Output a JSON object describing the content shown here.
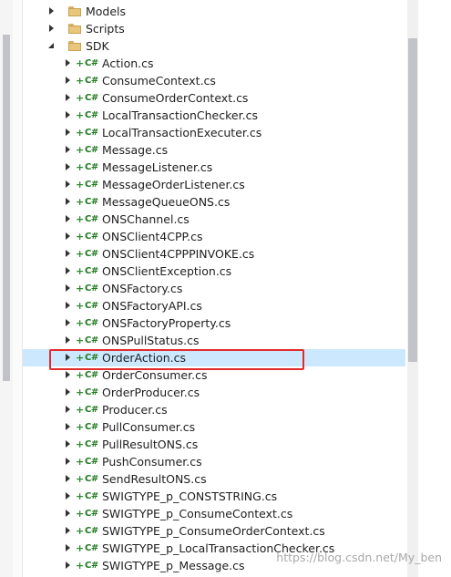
{
  "tree": {
    "folders": [
      {
        "label": "Models",
        "state": "collapsed"
      },
      {
        "label": "Scripts",
        "state": "collapsed"
      },
      {
        "label": "SDK",
        "state": "expanded"
      }
    ],
    "file_icon": "C#",
    "file_status_icon": "+",
    "files": [
      "Action.cs",
      "ConsumeContext.cs",
      "ConsumeOrderContext.cs",
      "LocalTransactionChecker.cs",
      "LocalTransactionExecuter.cs",
      "Message.cs",
      "MessageListener.cs",
      "MessageOrderListener.cs",
      "MessageQueueONS.cs",
      "ONSChannel.cs",
      "ONSClient4CPP.cs",
      "ONSClient4CPPPINVOKE.cs",
      "ONSClientException.cs",
      "ONSFactory.cs",
      "ONSFactoryAPI.cs",
      "ONSFactoryProperty.cs",
      "ONSPullStatus.cs",
      "OrderAction.cs",
      "OrderConsumer.cs",
      "OrderProducer.cs",
      "Producer.cs",
      "PullConsumer.cs",
      "PullResultONS.cs",
      "PushConsumer.cs",
      "SendResultONS.cs",
      "SWIGTYPE_p_CONSTSTRING.cs",
      "SWIGTYPE_p_ConsumeContext.cs",
      "SWIGTYPE_p_ConsumeOrderContext.cs",
      "SWIGTYPE_p_LocalTransactionChecker.cs",
      "SWIGTYPE_p_Message.cs"
    ],
    "selected_file": "OrderAction.cs"
  },
  "colors": {
    "selection": "#cce8ff",
    "highlight_border": "#e32b2b",
    "csharp_icon": "#1f7a1f",
    "folder": "#e8c77d"
  },
  "watermark": "https://blog.csdn.net/My_ben"
}
